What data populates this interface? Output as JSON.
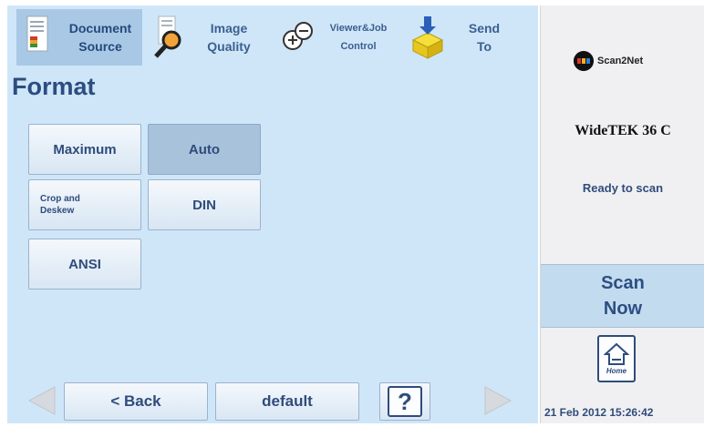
{
  "tabs": [
    {
      "line1": "Document",
      "line2": "Source",
      "icon": "document-source-icon",
      "active": true
    },
    {
      "line1": "Image",
      "line2": "Quality",
      "icon": "magnifier-icon",
      "active": false
    },
    {
      "line1": "Viewer&Job",
      "line2": "Control",
      "icon": "viewer-job-icon",
      "active": false
    },
    {
      "line1": "Send",
      "line2": "To",
      "icon": "send-package-icon",
      "active": false
    }
  ],
  "main": {
    "title": "Format",
    "options": [
      {
        "label": "Maximum",
        "selected": false
      },
      {
        "label": "Auto",
        "selected": true
      },
      {
        "label_line1": "Crop and",
        "label_line2": "Deskew",
        "selected": false
      },
      {
        "label": "DIN",
        "selected": false
      },
      {
        "label": "ANSI",
        "selected": false
      }
    ]
  },
  "bottom": {
    "back_label": "< Back",
    "default_label": "default",
    "help_label": "?",
    "left_arrow_icon": "arrow-left-icon",
    "right_arrow_icon": "arrow-right-icon"
  },
  "side": {
    "logo_text": "Scan2Net",
    "device": "WideTEK 36 C",
    "status": "Ready to scan",
    "scan_line1": "Scan",
    "scan_line2": "Now",
    "home_label": "Home",
    "datetime": "21 Feb 2012 15:26:42"
  },
  "colors": {
    "panel_bg": "#cfe6f8",
    "text_blue": "#2f4c7c",
    "selected_bg": "#a8c2dc",
    "scan_bg": "#c2dbef"
  }
}
